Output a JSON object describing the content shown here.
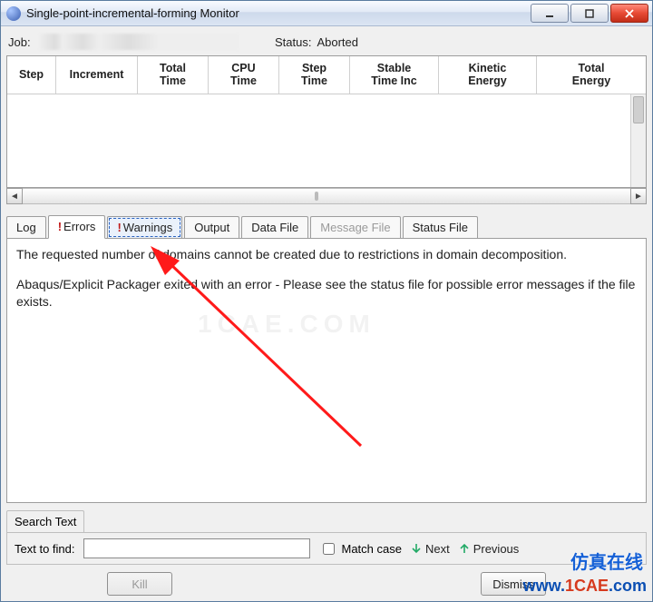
{
  "titlebar": {
    "title": "Single-point-incremental-forming Monitor"
  },
  "job": {
    "label": "Job:",
    "value": ""
  },
  "status": {
    "label": "Status:",
    "value": "Aborted"
  },
  "table": {
    "columns": [
      "Step",
      "Increment",
      "Total\nTime",
      "CPU\nTime",
      "Step\nTime",
      "Stable\nTime Inc",
      "Kinetic\nEnergy",
      "Total\nEnergy"
    ]
  },
  "tabs": {
    "items": [
      {
        "label": "Log",
        "bang": false,
        "active": false,
        "disabled": false
      },
      {
        "label": "Errors",
        "bang": true,
        "active": true,
        "disabled": false
      },
      {
        "label": "Warnings",
        "bang": true,
        "active": false,
        "disabled": false,
        "highlight": true
      },
      {
        "label": "Output",
        "bang": false,
        "active": false,
        "disabled": false
      },
      {
        "label": "Data File",
        "bang": false,
        "active": false,
        "disabled": false
      },
      {
        "label": "Message File",
        "bang": false,
        "active": false,
        "disabled": true
      },
      {
        "label": "Status File",
        "bang": false,
        "active": false,
        "disabled": false
      }
    ]
  },
  "errors": {
    "line1": "The requested number of domains cannot be created due to restrictions in domain decomposition.",
    "line2": "Abaqus/Explicit Packager exited with an error - Please see the status file for possible error messages if the file exists."
  },
  "search": {
    "header": "Search Text",
    "find_label": "Text to find:",
    "value": "",
    "match_label": "Match case",
    "next_label": "Next",
    "prev_label": "Previous"
  },
  "buttons": {
    "kill": "Kill",
    "dismiss": "Dismiss"
  },
  "brand": {
    "line1": "仿真在线",
    "line2_a": "www.",
    "line2_b": "1CAE",
    "line2_c": ".com"
  },
  "watermark": "1CAE.COM"
}
